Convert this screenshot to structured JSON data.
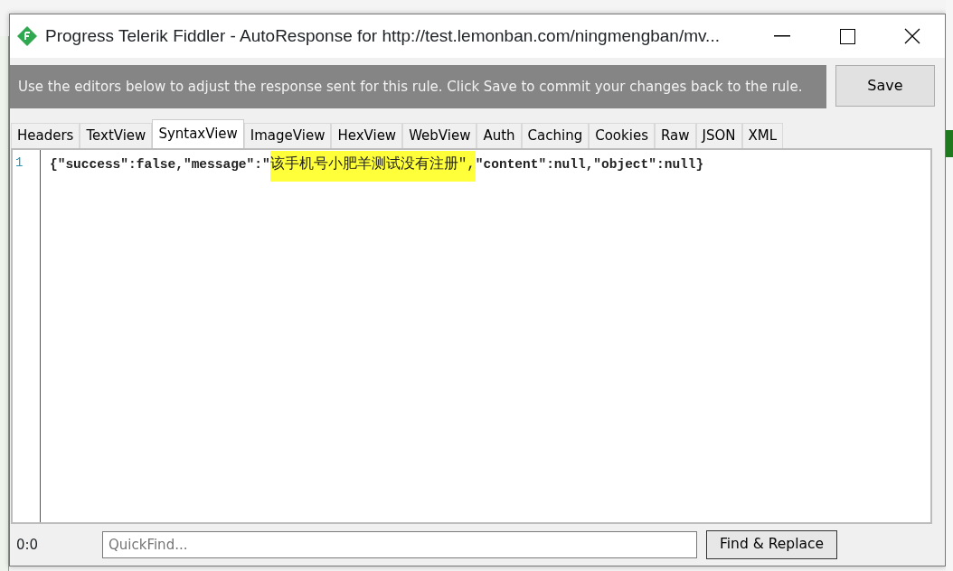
{
  "window": {
    "title": "Progress Telerik Fiddler - AutoResponse for http://test.lemonban.com/ningmengban/mv..."
  },
  "banner": {
    "text": "Use the editors below to adjust the response sent for this rule. Click Save to commit your changes back to the rule."
  },
  "save_button": "Save",
  "tabs": [
    {
      "label": "Headers",
      "selected": false
    },
    {
      "label": "TextView",
      "selected": false
    },
    {
      "label": "SyntaxView",
      "selected": true
    },
    {
      "label": "ImageView",
      "selected": false
    },
    {
      "label": "HexView",
      "selected": false
    },
    {
      "label": "WebView",
      "selected": false
    },
    {
      "label": "Auth",
      "selected": false
    },
    {
      "label": "Caching",
      "selected": false
    },
    {
      "label": "Cookies",
      "selected": false
    },
    {
      "label": "Raw",
      "selected": false
    },
    {
      "label": "JSON",
      "selected": false
    },
    {
      "label": "XML",
      "selected": false
    }
  ],
  "editor": {
    "lines": [
      {
        "number": "1",
        "segments": [
          {
            "text": "{\"success\":false,\"message\":\"",
            "highlighted": false
          },
          {
            "text": "该手机号小肥羊测试没有注册\",",
            "highlighted": true
          },
          {
            "text": "\"content\":null,\"object\":null}",
            "highlighted": false
          }
        ]
      }
    ]
  },
  "status_bar": {
    "position": "0:0",
    "quickfind": {
      "placeholder": "QuickFind..."
    },
    "find_replace_button": "Find & Replace"
  }
}
